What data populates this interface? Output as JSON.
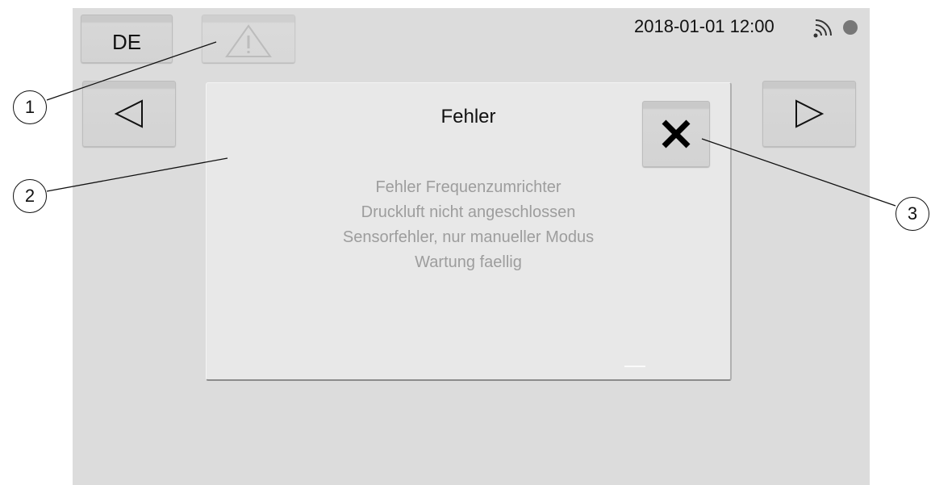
{
  "header": {
    "language_label": "DE",
    "datetime": "2018-01-01 12:00",
    "wifi_icon": "wifi-icon",
    "status_color": "#777777"
  },
  "nav": {
    "prev_icon": "triangle-left-icon",
    "next_icon": "triangle-right-icon",
    "warning_icon": "warning-triangle-icon"
  },
  "dialog": {
    "title": "Fehler",
    "close_icon": "close-x-icon",
    "errors": [
      "Fehler Frequenzumrichter",
      "Druckluft nicht angeschlossen",
      "Sensorfehler, nur manueller Modus",
      "Wartung faellig"
    ]
  },
  "callouts": [
    "1",
    "2",
    "3"
  ]
}
